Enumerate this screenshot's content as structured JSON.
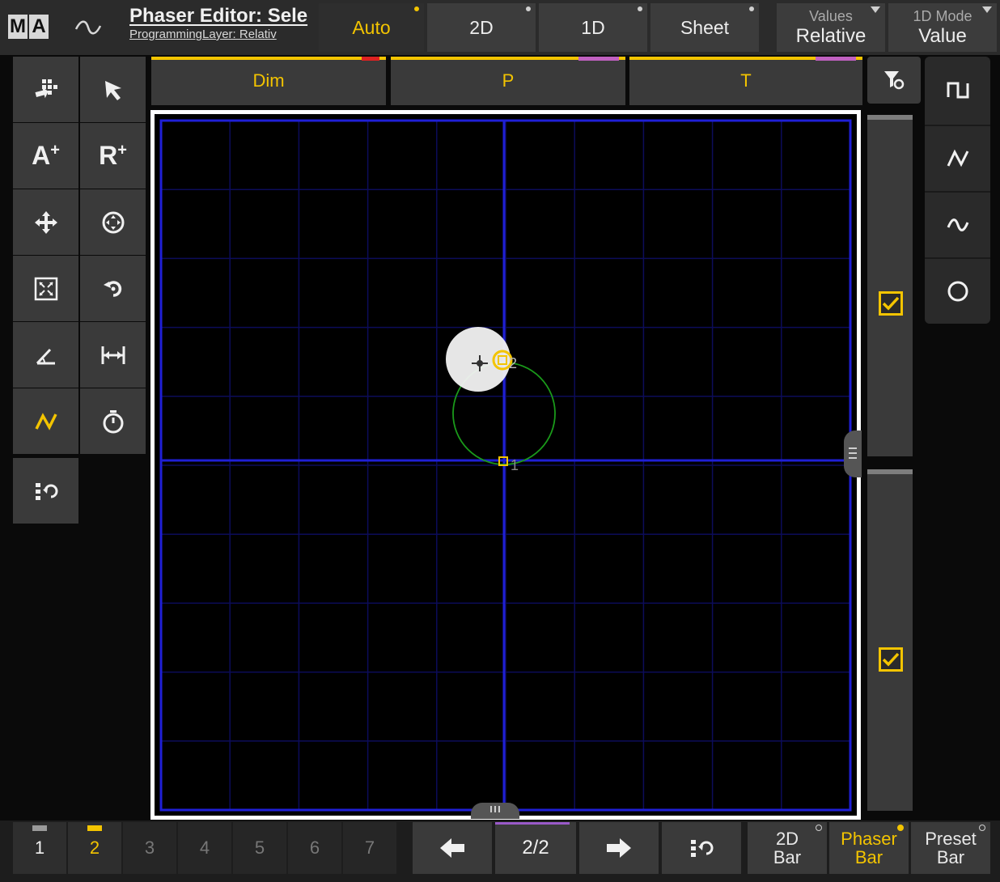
{
  "app": {
    "logo": [
      "M",
      "A"
    ],
    "title": "Phaser Editor: Sele",
    "subtitle": "ProgrammingLayer: Relativ"
  },
  "top_tabs": [
    {
      "label": "Auto",
      "active": true
    },
    {
      "label": "2D",
      "active": false
    },
    {
      "label": "1D",
      "active": false
    },
    {
      "label": "Sheet",
      "active": false
    }
  ],
  "values_dropdown": {
    "label": "Values",
    "value": "Relative"
  },
  "mode_dropdown": {
    "label": "1D Mode",
    "value": "Value"
  },
  "attributes": [
    "Dim",
    "P",
    "T"
  ],
  "left_tools": [
    {
      "icon": "grid-select-icon"
    },
    {
      "icon": "arrow-pointer-icon"
    },
    {
      "icon": "absolute-add-icon",
      "text": "A+"
    },
    {
      "icon": "relative-add-icon",
      "text": "R+"
    },
    {
      "icon": "move-icon"
    },
    {
      "icon": "center-target-icon"
    },
    {
      "icon": "fit-screen-icon"
    },
    {
      "icon": "rotate-icon"
    },
    {
      "icon": "angle-icon"
    },
    {
      "icon": "width-icon"
    },
    {
      "icon": "zigzag-icon",
      "active": true
    },
    {
      "icon": "stopwatch-icon"
    },
    {
      "icon": "list-refresh-icon"
    }
  ],
  "graph": {
    "point_labels": [
      "1",
      "2"
    ]
  },
  "right_forms": [
    "square-wave-icon",
    "zigzag-icon",
    "sine-wave-icon",
    "circle-icon"
  ],
  "checkboxes": [
    {
      "checked": true
    },
    {
      "checked": true
    }
  ],
  "pages": [
    {
      "label": "1",
      "state": "normal"
    },
    {
      "label": "2",
      "state": "active"
    },
    {
      "label": "3",
      "state": "dim"
    },
    {
      "label": "4",
      "state": "dim"
    },
    {
      "label": "5",
      "state": "dim"
    },
    {
      "label": "6",
      "state": "dim"
    },
    {
      "label": "7",
      "state": "dim"
    }
  ],
  "pagination": "2/2",
  "bottom_bars": [
    {
      "line1": "2D",
      "line2": "Bar",
      "active": false
    },
    {
      "line1": "Phaser",
      "line2": "Bar",
      "active": true
    },
    {
      "line1": "Preset",
      "line2": "Bar",
      "active": false
    }
  ],
  "colors": {
    "accent": "#f3c400",
    "grid_major": "#1f1fd6",
    "grid_minor": "#0c0c5a",
    "path": "#1a9a1a",
    "panel": "#3a3a3a"
  }
}
